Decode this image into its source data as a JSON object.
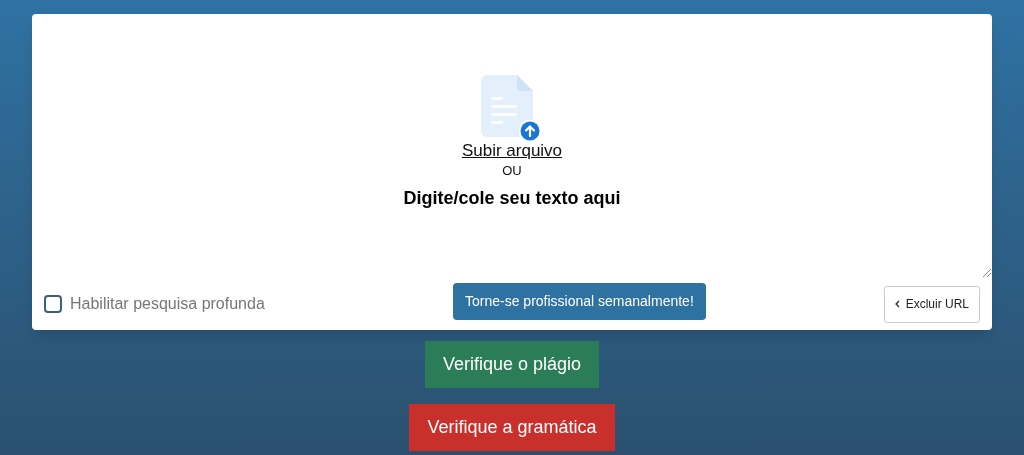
{
  "editor": {
    "upload_link": "Subir arquivo",
    "separator": "OU",
    "placeholder": "Digite/cole seu texto aqui"
  },
  "deep_search": {
    "label": "Habilitar pesquisa profunda",
    "checked": false
  },
  "promo_button": "Torne-se profissional semanalmente!",
  "exclude_url_button": "Excluir URL",
  "actions": [
    {
      "label": "Verifique o plágio",
      "color": "#2a7d56"
    },
    {
      "label": "Verifique a gramática",
      "color": "#c9302c"
    }
  ]
}
